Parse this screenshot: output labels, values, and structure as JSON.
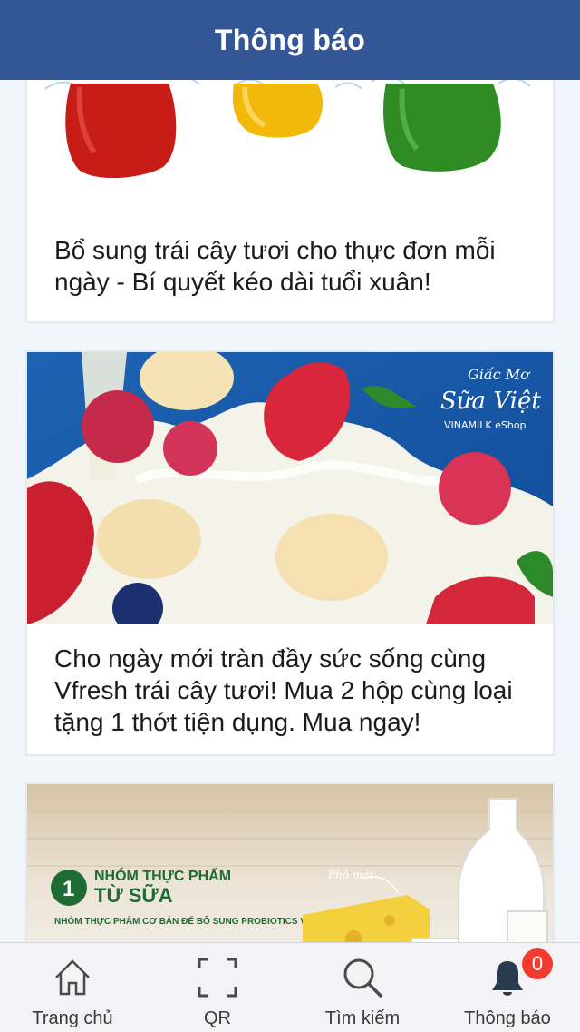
{
  "header": {
    "title": "Thông báo"
  },
  "notifications": [
    {
      "text": "Bổ sung trái cây tươi cho thực đơn mỗi ngày - Bí quyết kéo dài tuổi xuân!",
      "image": "bell-peppers-photo"
    },
    {
      "text": "Cho ngày mới tràn đầy sức sống cùng Vfresh trái cây tươi! Mua 2 hộp cùng loại tặng 1 thớt tiện dụng. Mua ngay!",
      "image": "fruit-milk-splash-photo",
      "brand_lines": [
        "Giấc Mơ",
        "Sữa Việt",
        "VINAMILK eShop"
      ]
    },
    {
      "text": "",
      "image": "dairy-food-group-photo",
      "image_texts": {
        "number": "1",
        "heading_1": "NHÓM THỰC PHẨM",
        "heading_2": "TỪ SỮA",
        "body": "NHÓM THỰC PHẨM CƠ BẢN ĐỂ BỔ SUNG PROBIOTICS VÌ SỮA TẠO MÔI",
        "cheese_label": "Phô mát"
      }
    }
  ],
  "tabbar": {
    "tabs": [
      {
        "label": "Trang chủ",
        "icon": "home-icon"
      },
      {
        "label": "QR",
        "icon": "qr-scan-icon"
      },
      {
        "label": "Tìm kiếm",
        "icon": "search-icon"
      },
      {
        "label": "Thông báo",
        "icon": "bell-icon",
        "badge": "0"
      }
    ]
  },
  "colors": {
    "header_bg": "#335697",
    "page_bg": "#f0f6fb",
    "badge": "#f23a2f",
    "tabbar_bg": "#f3f3f5"
  }
}
